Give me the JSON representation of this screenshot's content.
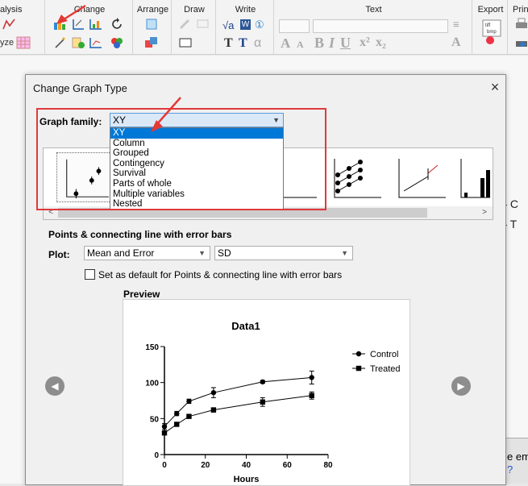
{
  "ribbon": {
    "groups": {
      "analysis": "alysis",
      "change": "Change",
      "arrange": "Arrange",
      "draw": "Draw",
      "write": "Write",
      "text": "Text",
      "export": "Export",
      "print": "Print"
    },
    "analyze_label": "yze",
    "write_glyphs": [
      "√a",
      "W",
      "①",
      "T",
      "T",
      "α"
    ],
    "text_glyphs": [
      "A",
      "A",
      "B",
      "I",
      "U",
      "x²",
      "x₂"
    ],
    "export_glyph": "tiff bmp"
  },
  "background": {
    "lines": [
      "C",
      "T"
    ],
    "bottom_panel": [
      "e em",
      "?"
    ]
  },
  "dialog": {
    "title": "Change Graph Type",
    "close": "×",
    "graph_family_label": "Graph family:",
    "graph_family_value": "XY",
    "graph_family_options": [
      "XY",
      "Column",
      "Grouped",
      "Contingency",
      "Survival",
      "Parts of whole",
      "Multiple variables",
      "Nested"
    ],
    "section_title": "Points & connecting line with error bars",
    "plot_label": "Plot:",
    "plot_value": "Mean and Error",
    "error_value": "SD",
    "default_checkbox_label": "Set as default for Points & connecting line with error bars",
    "preview_label": "Preview",
    "prev_button": "◀",
    "next_button": "▶",
    "scroll_left": "<",
    "scroll_right": ">"
  },
  "chart_data": {
    "type": "line",
    "title": "Data1",
    "xlabel": "Hours",
    "ylabel": "",
    "xlim": [
      0,
      80
    ],
    "ylim": [
      0,
      150
    ],
    "xticks": [
      0,
      20,
      40,
      60,
      80
    ],
    "yticks": [
      0,
      50,
      100,
      150
    ],
    "legend_position": "top-right",
    "series": [
      {
        "name": "Control",
        "marker": "circle",
        "x": [
          0,
          6,
          12,
          24,
          48,
          72
        ],
        "y": [
          39,
          57,
          74,
          86,
          101,
          107
        ],
        "err": [
          4,
          3,
          3,
          7,
          2,
          9
        ]
      },
      {
        "name": "Treated",
        "marker": "square",
        "x": [
          0,
          6,
          12,
          24,
          48,
          72
        ],
        "y": [
          30,
          42,
          53,
          62,
          73,
          82
        ],
        "err": [
          2,
          2,
          2,
          3,
          6,
          5
        ]
      }
    ]
  },
  "colors": {
    "selection": "#0078d7",
    "highlight_box": "#e0393b",
    "annotation_arrow": "#e53935"
  }
}
